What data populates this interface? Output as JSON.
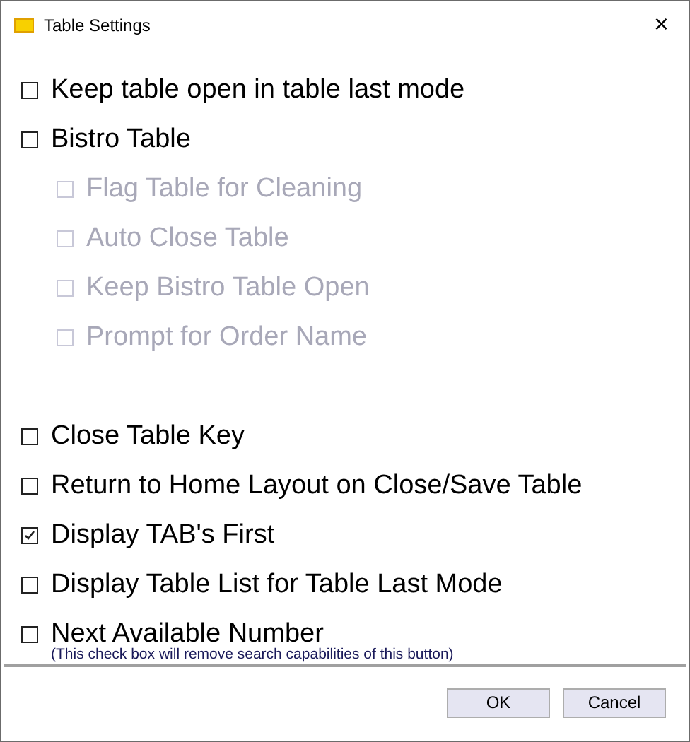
{
  "window": {
    "title": "Table Settings",
    "close": "×"
  },
  "options": [
    {
      "label": "Keep table open in table last mode",
      "checked": false,
      "disabled": false
    },
    {
      "label": "Bistro Table",
      "checked": false,
      "disabled": false,
      "children": [
        {
          "label": "Flag Table for Cleaning",
          "checked": false,
          "disabled": true
        },
        {
          "label": "Auto Close Table",
          "checked": false,
          "disabled": true
        },
        {
          "label": "Keep Bistro Table Open",
          "checked": false,
          "disabled": true
        },
        {
          "label": "Prompt for Order Name",
          "checked": false,
          "disabled": true
        }
      ]
    },
    {
      "label": "Close Table Key",
      "checked": false,
      "disabled": false
    },
    {
      "label": "Return to Home Layout on Close/Save Table",
      "checked": false,
      "disabled": false
    },
    {
      "label": "Display TAB's First",
      "checked": true,
      "disabled": false
    },
    {
      "label": "Display Table List for Table Last Mode",
      "checked": false,
      "disabled": false
    },
    {
      "label": "Next Available Number",
      "checked": false,
      "disabled": false,
      "note": "(This check box will remove search capabilities of this button)"
    }
  ],
  "buttons": [
    "OK",
    "Cancel"
  ]
}
